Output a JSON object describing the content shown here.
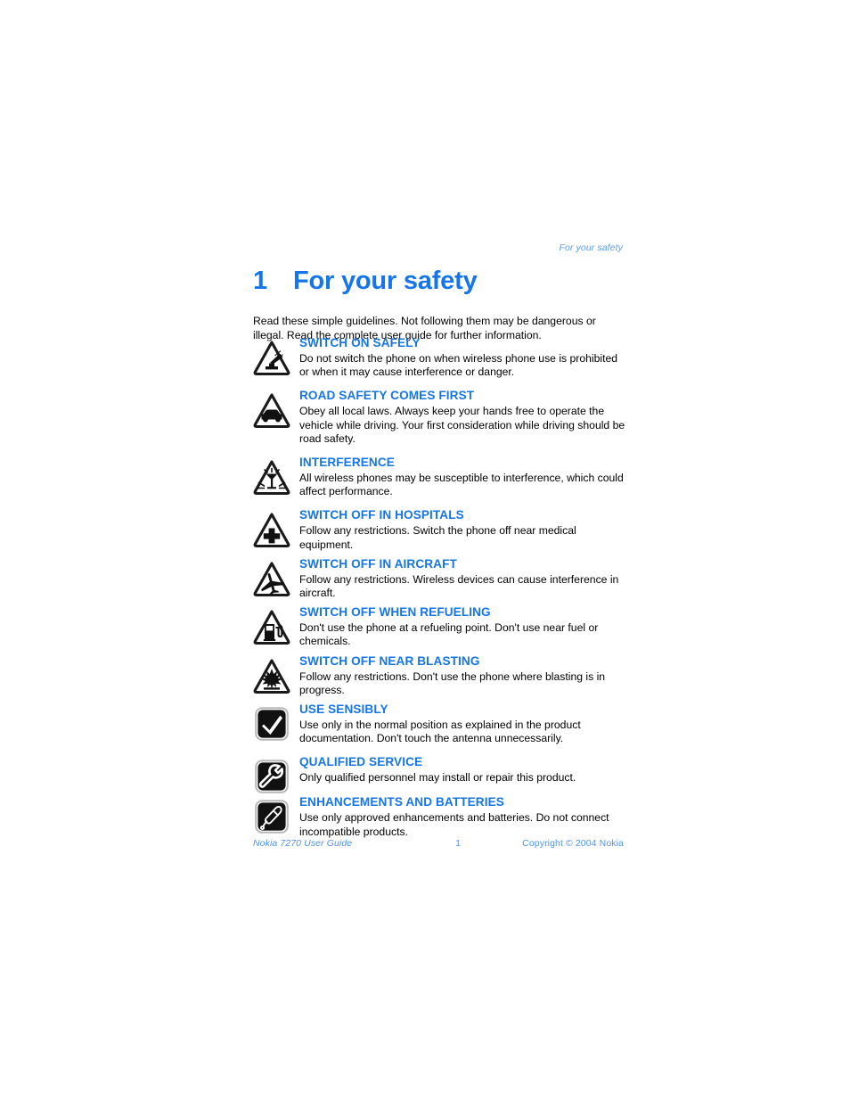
{
  "document": {
    "running_header": "For your safety",
    "chapter_number": "1",
    "chapter_title": "For your safety",
    "intro": "Read these simple guidelines. Not following them may be dangerous or illegal. Read the complete user guide for further information."
  },
  "colors": {
    "heading_blue": "#1675e8",
    "header_blue": "#5b9bf0",
    "footer_blue": "#4f93ef",
    "body_black": "#000000",
    "page_background": "#ffffff"
  },
  "sections": [
    {
      "icon": "warning-triangle-switch-on-icon",
      "heading": "SWITCH ON SAFELY",
      "body": "Do not switch the phone on when wireless phone use is prohibited or when it may cause interference or danger."
    },
    {
      "icon": "warning-triangle-car-icon",
      "heading": "ROAD SAFETY COMES FIRST",
      "body": "Obey all local laws. Always keep your hands free to operate the vehicle while driving. Your first consideration while driving should be road safety."
    },
    {
      "icon": "warning-triangle-interference-icon",
      "heading": "INTERFERENCE",
      "body": "All wireless phones may be susceptible to interference, which could affect performance."
    },
    {
      "icon": "warning-triangle-hospital-cross-icon",
      "heading": "SWITCH OFF IN HOSPITALS",
      "body": "Follow any restrictions. Switch the phone off near medical equipment."
    },
    {
      "icon": "warning-triangle-airplane-icon",
      "heading": "SWITCH OFF IN AIRCRAFT",
      "body": "Follow any restrictions. Wireless devices can cause interference in aircraft."
    },
    {
      "icon": "warning-triangle-fuel-pump-icon",
      "heading": "SWITCH OFF WHEN REFUELING",
      "body": "Don't use the phone at a refueling point. Don't use near fuel or chemicals."
    },
    {
      "icon": "warning-triangle-blasting-icon",
      "heading": "SWITCH OFF NEAR BLASTING",
      "body": "Follow any restrictions. Don't use the phone where blasting is in progress."
    },
    {
      "icon": "rounded-square-checkmark-icon",
      "heading": "USE SENSIBLY",
      "body": "Use only in the normal position as explained in the product documentation. Don't touch the antenna unnecessarily."
    },
    {
      "icon": "rounded-square-wrench-icon",
      "heading": "QUALIFIED SERVICE",
      "body": "Only qualified personnel may install or repair this product."
    },
    {
      "icon": "rounded-square-headset-icon",
      "heading": "ENHANCEMENTS AND BATTERIES",
      "body": "Use only approved enhancements and batteries. Do not connect incompatible products."
    }
  ],
  "footer": {
    "left": "Nokia 7270 User Guide",
    "page_number": "1",
    "right": "Copyright © 2004 Nokia"
  }
}
